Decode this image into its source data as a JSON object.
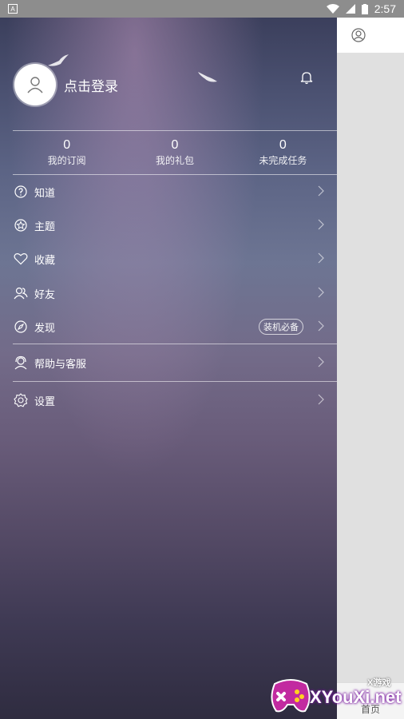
{
  "status_bar": {
    "time": "2:57"
  },
  "profile": {
    "login_label": "点击登录"
  },
  "stats": [
    {
      "value": "0",
      "label": "我的订阅"
    },
    {
      "value": "0",
      "label": "我的礼包"
    },
    {
      "value": "0",
      "label": "未完成任务"
    }
  ],
  "menu": {
    "know": "知道",
    "topic": "主题",
    "favorite": "收藏",
    "friends": "好友",
    "discover": "发现",
    "discover_badge": "装机必备",
    "help": "帮助与客服",
    "settings": "设置"
  },
  "main": {
    "home_tab": "首页"
  },
  "watermark": {
    "small": "X游戏",
    "big": "XYouXi.net"
  },
  "colors": {
    "drawer_top": "#3b3f5c",
    "drawer_mid": "#736b89",
    "drawer_bottom": "#2f2c40"
  }
}
